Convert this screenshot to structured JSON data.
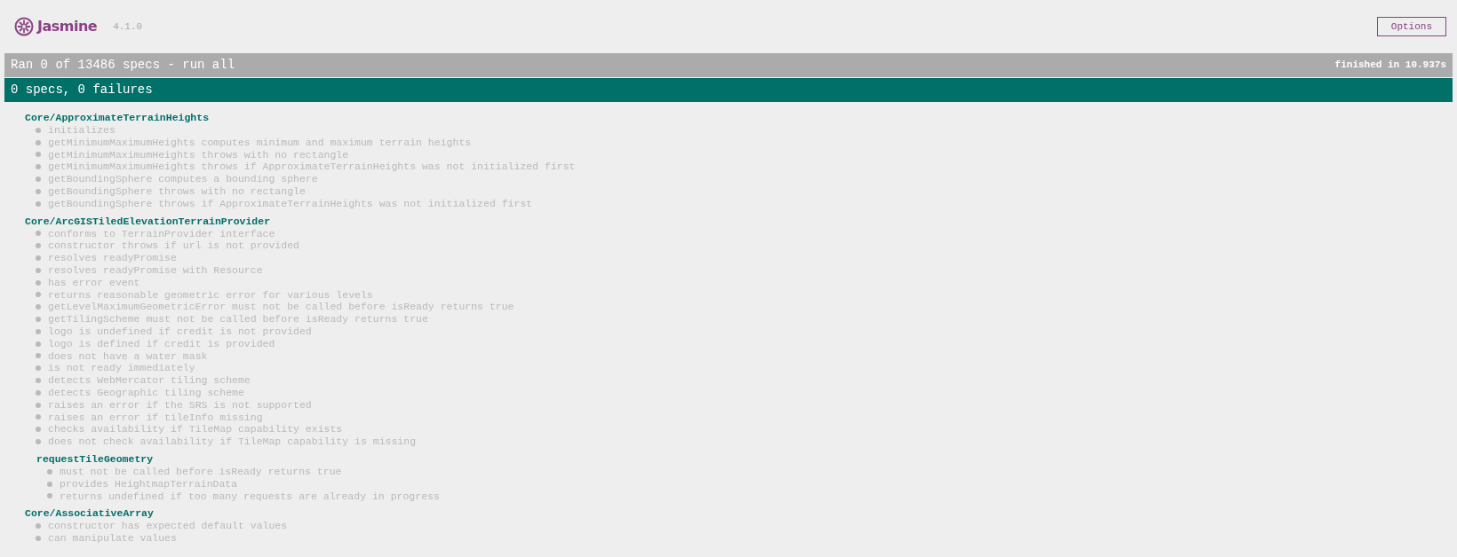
{
  "banner": {
    "logo_text": "Jasmine",
    "version": "4.1.0",
    "options_button": "Options"
  },
  "run_bar": {
    "text": "Ran 0 of 13486 specs - run all",
    "duration": "finished in 10.937s"
  },
  "summary_bar": {
    "text": "0 specs, 0 failures"
  },
  "suites": [
    {
      "title": "Core/ApproximateTerrainHeights",
      "specs": [
        "initializes",
        "getMinimumMaximumHeights computes minimum and maximum terrain heights",
        "getMinimumMaximumHeights throws with no rectangle",
        "getMinimumMaximumHeights throws if ApproximateTerrainHeights was not initialized first",
        "getBoundingSphere computes a bounding sphere",
        "getBoundingSphere throws with no rectangle",
        "getBoundingSphere throws if ApproximateTerrainHeights was not initialized first"
      ]
    },
    {
      "title": "Core/ArcGISTiledElevationTerrainProvider",
      "specs": [
        "conforms to TerrainProvider interface",
        "constructor throws if url is not provided",
        "resolves readyPromise",
        "resolves readyPromise with Resource",
        "has error event",
        "returns reasonable geometric error for various levels",
        "getLevelMaximumGeometricError must not be called before isReady returns true",
        "getTilingScheme must not be called before isReady returns true",
        "logo is undefined if credit is not provided",
        "logo is defined if credit is provided",
        "does not have a water mask",
        "is not ready immediately",
        "detects WebMercator tiling scheme",
        "detects Geographic tiling scheme",
        "raises an error if the SRS is not supported",
        "raises an error if tileInfo missing",
        "checks availability if TileMap capability exists",
        "does not check availability if TileMap capability is missing"
      ],
      "children": [
        {
          "title": "requestTileGeometry",
          "specs": [
            "must not be called before isReady returns true",
            "provides HeightmapTerrainData",
            "returns undefined if too many requests are already in progress"
          ]
        }
      ]
    },
    {
      "title": "Core/AssociativeArray",
      "specs": [
        "constructor has expected default values",
        "can manipulate values"
      ]
    }
  ]
}
